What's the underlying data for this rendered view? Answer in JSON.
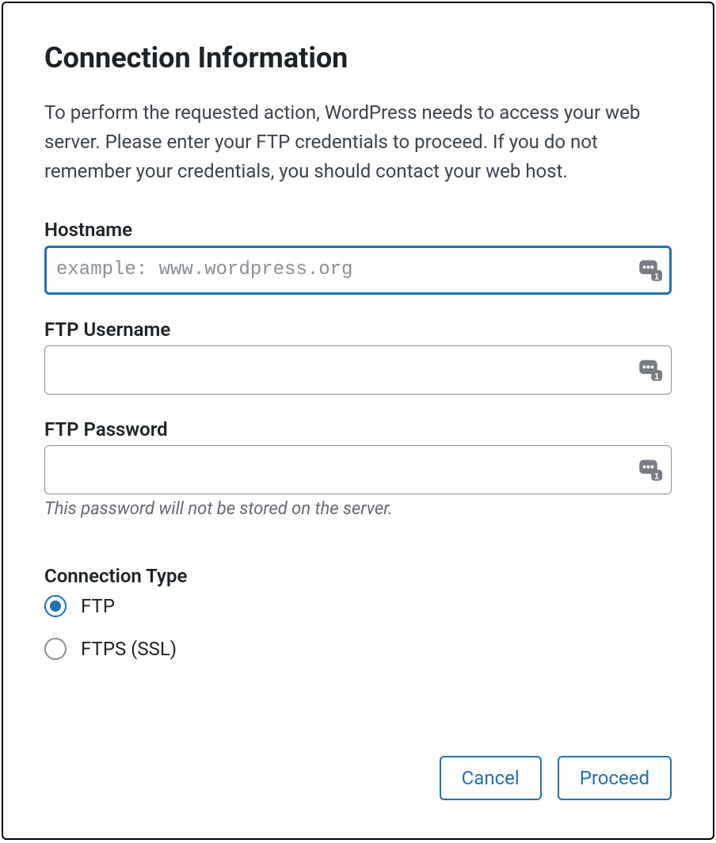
{
  "dialog": {
    "title": "Connection Information",
    "description": "To perform the requested action, WordPress needs to access your web server. Please enter your FTP credentials to proceed. If you do not remember your credentials, you should contact your web host."
  },
  "fields": {
    "hostname": {
      "label": "Hostname",
      "placeholder": "example: www.wordpress.org",
      "value": ""
    },
    "username": {
      "label": "FTP Username",
      "value": ""
    },
    "password": {
      "label": "FTP Password",
      "value": "",
      "hint": "This password will not be stored on the server."
    }
  },
  "connection_type": {
    "label": "Connection Type",
    "options": {
      "ftp": "FTP",
      "ftps": "FTPS (SSL)"
    },
    "selected": "ftp"
  },
  "buttons": {
    "cancel": "Cancel",
    "proceed": "Proceed"
  }
}
